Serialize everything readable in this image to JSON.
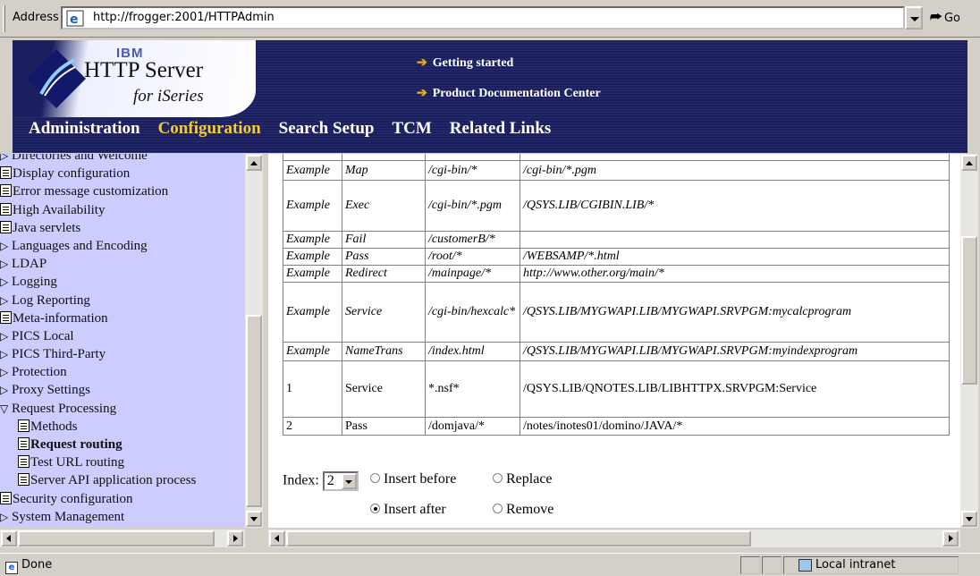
{
  "address_bar": {
    "label": "Address",
    "url": "http://frogger:2001/HTTPAdmin",
    "go_label": "Go"
  },
  "banner": {
    "ibm": "IBM",
    "title": "HTTP Server",
    "subtitle": "for iSeries",
    "links": [
      "Getting started",
      "Product Documentation Center"
    ],
    "nav": [
      "Administration",
      "Configuration",
      "Search Setup",
      "TCM",
      "Related Links"
    ],
    "active_nav": "Configuration",
    "colors": {
      "banner_bg": "#1b1f60",
      "active_nav": "#f2cc40",
      "sidebar_bg": "#ccccff"
    }
  },
  "sidebar": {
    "items": [
      {
        "label": "Directories and Welcome",
        "icon": "arrow-icon",
        "indent": 0
      },
      {
        "label": "Display configuration",
        "icon": "document-icon",
        "indent": 0
      },
      {
        "label": "Error message customization",
        "icon": "document-icon",
        "indent": 0
      },
      {
        "label": "High Availability",
        "icon": "document-icon",
        "indent": 0
      },
      {
        "label": "Java servlets",
        "icon": "document-icon",
        "indent": 0
      },
      {
        "label": "Languages and Encoding",
        "icon": "arrow-icon",
        "indent": 0
      },
      {
        "label": "LDAP",
        "icon": "arrow-icon",
        "indent": 0
      },
      {
        "label": "Logging",
        "icon": "arrow-icon",
        "indent": 0
      },
      {
        "label": "Log Reporting",
        "icon": "arrow-icon",
        "indent": 0
      },
      {
        "label": "Meta-information",
        "icon": "document-icon",
        "indent": 0
      },
      {
        "label": "PICS Local",
        "icon": "arrow-icon",
        "indent": 0
      },
      {
        "label": "PICS Third-Party",
        "icon": "arrow-icon",
        "indent": 0
      },
      {
        "label": "Protection",
        "icon": "arrow-icon",
        "indent": 0
      },
      {
        "label": "Proxy Settings",
        "icon": "arrow-icon",
        "indent": 0
      },
      {
        "label": "Request Processing",
        "icon": "arrow-down-icon",
        "indent": 0
      },
      {
        "label": "Methods",
        "icon": "document-icon",
        "indent": 1
      },
      {
        "label": "Request routing",
        "icon": "document-icon",
        "indent": 1,
        "selected": true
      },
      {
        "label": "Test URL routing",
        "icon": "document-icon",
        "indent": 1
      },
      {
        "label": "Server API application process",
        "icon": "document-icon",
        "indent": 1
      },
      {
        "label": "Security configuration",
        "icon": "document-icon",
        "indent": 0
      },
      {
        "label": "System Management",
        "icon": "arrow-icon",
        "indent": 0
      }
    ]
  },
  "table": {
    "rows": [
      {
        "c1": "",
        "c2": "",
        "c3": "",
        "c4": ""
      },
      {
        "c1": "Example",
        "c2": "Map",
        "c3": "/cgi-bin/*",
        "c4": "/cgi-bin/*.pgm"
      },
      {
        "c1": "Example",
        "c2": "Exec",
        "c3": "/cgi-bin/*.pgm",
        "c4": "/QSYS.LIB/CGIBIN.LIB/*"
      },
      {
        "c1": "Example",
        "c2": "Fail",
        "c3": "/customerB/*",
        "c4": ""
      },
      {
        "c1": "Example",
        "c2": "Pass",
        "c3": "/root/*",
        "c4": "/WEBSAMP/*.html"
      },
      {
        "c1": "Example",
        "c2": "Redirect",
        "c3": "/mainpage/*",
        "c4": "http://www.other.org/main/*"
      },
      {
        "c1": "Example",
        "c2": "Service",
        "c3": "/cgi-bin/hexcalc*",
        "c4": "/QSYS.LIB/MYGWAPI.LIB/MYGWAPI.SRVPGM:mycalcprogram"
      },
      {
        "c1": "Example",
        "c2": "NameTrans",
        "c3": "/index.html",
        "c4": "/QSYS.LIB/MYGWAPI.LIB/MYGWAPI.SRVPGM:myindexprogram"
      },
      {
        "c1": "1",
        "c2": "Service",
        "c3": "*.nsf*",
        "c4": "/QSYS.LIB/QNOTES.LIB/LIBHTTPX.SRVPGM:Service"
      },
      {
        "c1": "2",
        "c2": "Pass",
        "c3": "/domjava/*",
        "c4": "/notes/inotes01/domino/JAVA/*"
      }
    ]
  },
  "form": {
    "index_label": "Index:",
    "index_value": "2",
    "insert_before": "Insert before",
    "replace": "Replace",
    "insert_after": "Insert after",
    "remove": "Remove",
    "selected_option": "Insert after"
  },
  "statusbar": {
    "status": "Done",
    "zone": "Local intranet"
  }
}
